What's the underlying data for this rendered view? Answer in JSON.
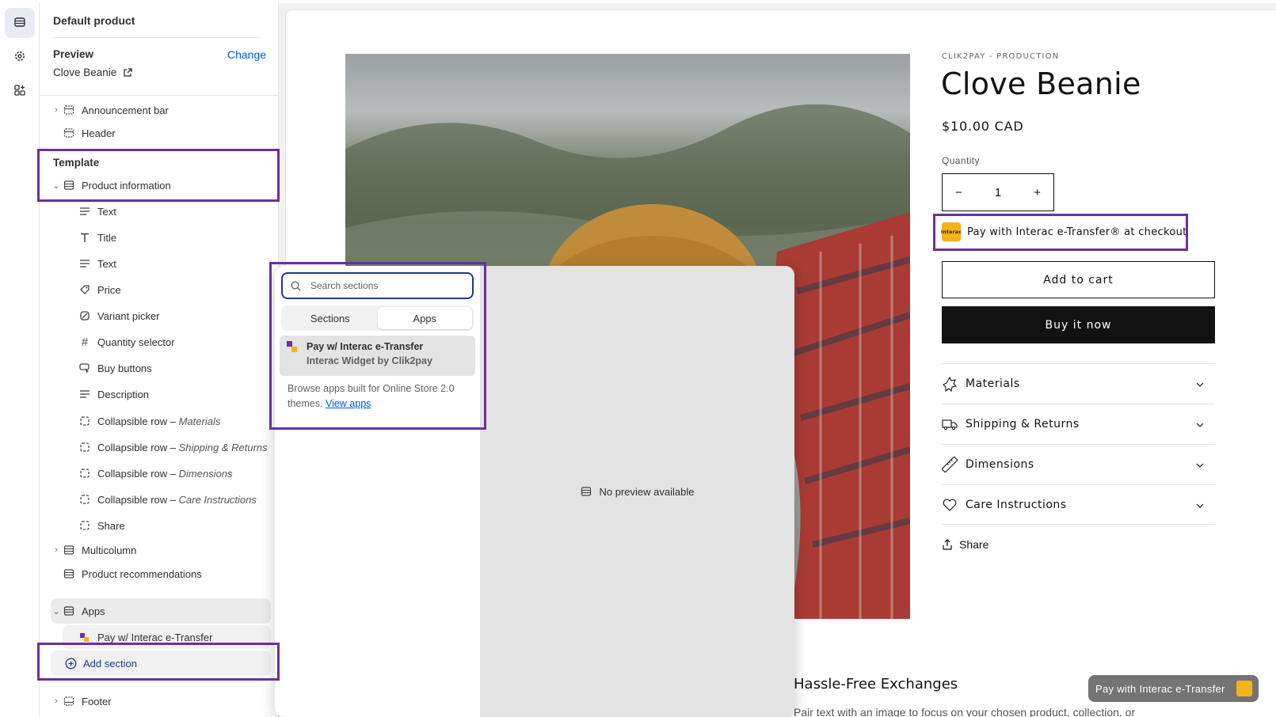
{
  "rail": {
    "items": [
      {
        "name": "sections",
        "icon": "sections-icon"
      },
      {
        "name": "theme-settings",
        "icon": "gear-icon"
      },
      {
        "name": "app-embeds",
        "icon": "apps-icon"
      }
    ]
  },
  "sidebar": {
    "page_title": "Default product",
    "preview_label": "Preview",
    "change_label": "Change",
    "preview_product": "Clove Beanie",
    "header_group": [
      {
        "label": "Announcement bar"
      },
      {
        "label": "Header"
      }
    ],
    "template_label": "Template",
    "product_information": "Product information",
    "blocks": [
      {
        "label": "Text",
        "suffix": ""
      },
      {
        "label": "Title",
        "suffix": ""
      },
      {
        "label": "Text",
        "suffix": ""
      },
      {
        "label": "Price",
        "suffix": ""
      },
      {
        "label": "Variant picker",
        "suffix": ""
      },
      {
        "label": "Quantity selector",
        "suffix": ""
      },
      {
        "label": "Buy buttons",
        "suffix": ""
      },
      {
        "label": "Description",
        "suffix": ""
      },
      {
        "label": "Collapsible row",
        "suffix": "Materials"
      },
      {
        "label": "Collapsible row",
        "suffix": "Shipping & Returns"
      },
      {
        "label": "Collapsible row",
        "suffix": "Dimensions"
      },
      {
        "label": "Collapsible row",
        "suffix": "Care Instructions"
      },
      {
        "label": "Share",
        "suffix": ""
      }
    ],
    "separator": " – ",
    "multicolumn": "Multicolumn",
    "product_recommendations": "Product recommendations",
    "apps": "Apps",
    "app_block": "Pay w/ Interac e-Transfer",
    "add_section": "Add section",
    "footer": "Footer"
  },
  "popover": {
    "search_placeholder": "Search sections",
    "tabs": [
      {
        "label": "Sections",
        "active": false
      },
      {
        "label": "Apps",
        "active": true
      }
    ],
    "app_name": "Pay w/ Interac e-Transfer",
    "app_subtitle": "Interac Widget by Clik2pay",
    "browse_text": "Browse apps built for Online Store 2.0 themes.",
    "view_apps": "View apps",
    "no_preview": "No preview available"
  },
  "product": {
    "vendor": "CLIK2PAY - PRODUCTION",
    "title": "Clove Beanie",
    "price": "$10.00 CAD",
    "quantity_label": "Quantity",
    "quantity_value": "1",
    "minus": "−",
    "plus": "+",
    "interac_text": "Pay with Interac e-Transfer® at checkout",
    "interac_logo_text": "Interac",
    "add_to_cart": "Add to cart",
    "buy_now": "Buy it now",
    "accordions": [
      {
        "label": "Materials",
        "icon": "leaf-icon"
      },
      {
        "label": "Shipping & Returns",
        "icon": "truck-icon"
      },
      {
        "label": "Dimensions",
        "icon": "ruler-icon"
      },
      {
        "label": "Care Instructions",
        "icon": "heart-icon"
      }
    ],
    "share": "Share",
    "section_heading": "Hassle-Free Exchanges",
    "section_body": "Pair text with an image to focus on your chosen product, collection, or"
  },
  "floating_button": {
    "label": "Pay with Interac e-Transfer"
  },
  "colors": {
    "highlight_border": "#6b2fa3",
    "link_blue": "#005bd3",
    "interac_yellow": "#f5b31a",
    "buy_now_bg": "#121212"
  }
}
